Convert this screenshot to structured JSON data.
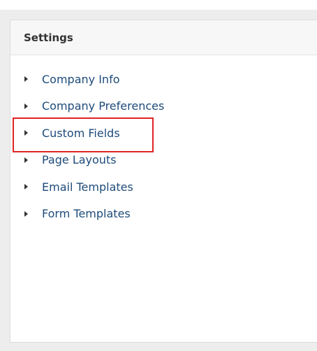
{
  "panel": {
    "title": "Settings"
  },
  "settings": {
    "items": [
      {
        "label": "Company Info",
        "icon": "caret-right-icon"
      },
      {
        "label": "Company Preferences",
        "icon": "caret-right-icon"
      },
      {
        "label": "Custom Fields",
        "icon": "caret-right-icon",
        "highlighted": true
      },
      {
        "label": "Page Layouts",
        "icon": "caret-right-icon"
      },
      {
        "label": "Email Templates",
        "icon": "caret-right-icon"
      },
      {
        "label": "Form Templates",
        "icon": "caret-right-icon"
      }
    ]
  },
  "colors": {
    "link": "#1e4b7a",
    "highlight": "#e02424",
    "header_bg": "#f7f7f7",
    "frame_bg": "#ededed"
  }
}
